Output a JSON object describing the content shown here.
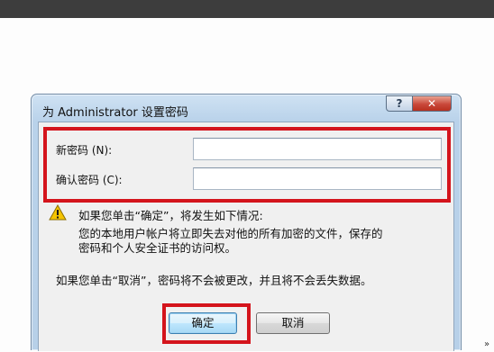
{
  "dialog": {
    "title": "为 Administrator 设置密码",
    "help_glyph": "?",
    "close_glyph": "✕"
  },
  "form": {
    "new_password_label": "新密码 (N):",
    "new_password_value": "",
    "confirm_password_label": "确认密码 (C):",
    "confirm_password_value": ""
  },
  "warning": {
    "heading": "如果您单击“确定”，将发生如下情况:",
    "line1": "您的本地用户帐户将立即失去对他的所有加密的文件，保存的",
    "line2": "密码和个人安全证书的访问权。"
  },
  "cancel_note": "如果您单击“取消”，密码将不会被更改，并且将不会丢失数据。",
  "buttons": {
    "ok_label": "确定",
    "cancel_label": "取消"
  },
  "page": {
    "corner_mark": "»"
  },
  "colors": {
    "highlight": "#d4141c",
    "window_frame": "#b9d2ea",
    "warning_icon": "#f5c400"
  }
}
